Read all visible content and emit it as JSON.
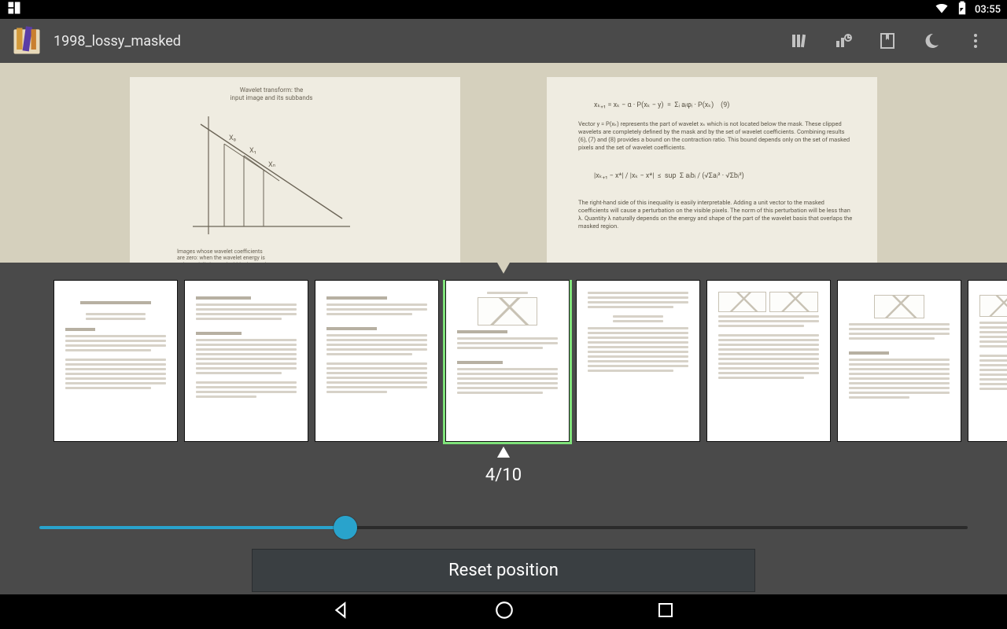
{
  "status": {
    "time": "03:55"
  },
  "header": {
    "title": "1998_lossy_masked"
  },
  "navigator": {
    "current_page": 4,
    "total_pages": 10,
    "indicator": "4/10",
    "slider_percent": 33,
    "reset_label": "Reset position",
    "thumbnails": [
      {
        "page": 1,
        "selected": false
      },
      {
        "page": 2,
        "selected": false
      },
      {
        "page": 3,
        "selected": false
      },
      {
        "page": 4,
        "selected": true
      },
      {
        "page": 5,
        "selected": false
      },
      {
        "page": 6,
        "selected": false
      },
      {
        "page": 7,
        "selected": false
      },
      {
        "page": 8,
        "selected": false
      }
    ]
  },
  "toolbar_icons": [
    "library",
    "stats",
    "bookmarks",
    "night-mode",
    "overflow"
  ]
}
